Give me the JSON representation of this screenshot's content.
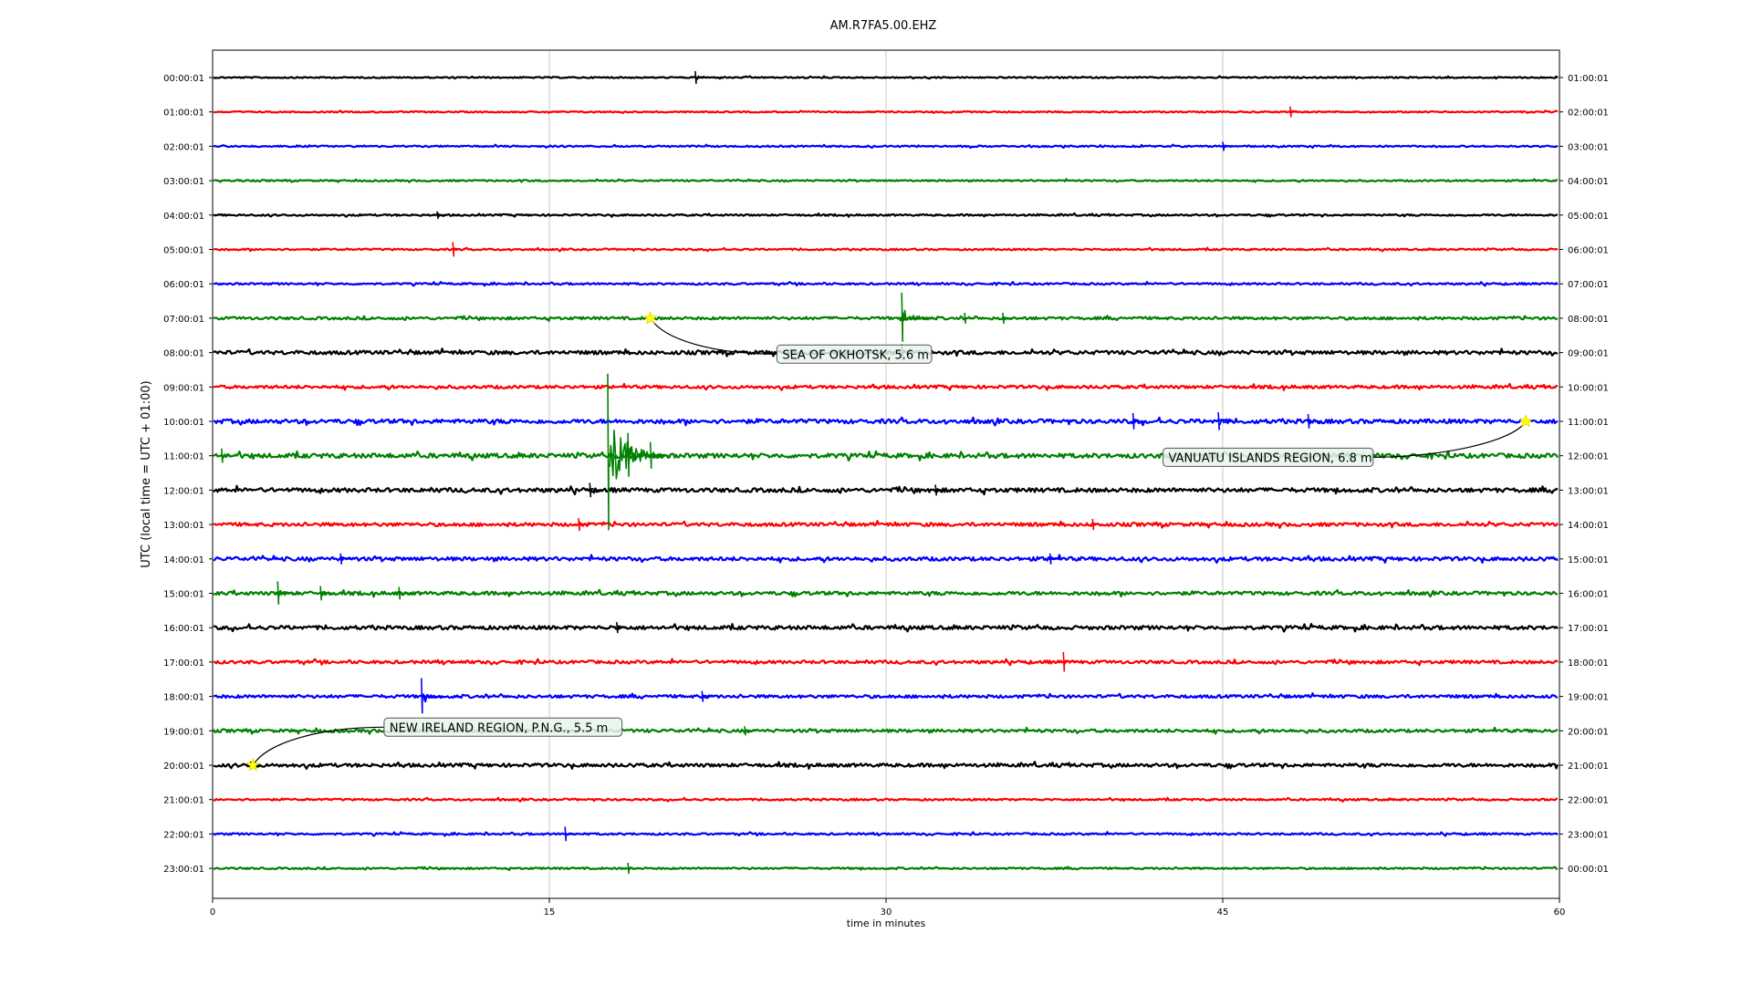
{
  "chart_data": {
    "type": "line",
    "title": "AM.R7FA5.00.EHZ",
    "xlabel": "time in minutes",
    "ylabel": "UTC (local time = UTC + 01:00)",
    "xlim": [
      0,
      60
    ],
    "x_ticks": [
      0,
      15,
      30,
      45,
      60
    ],
    "grid": "vertical",
    "trace_colors": [
      "#000000",
      "#ff0000",
      "#0000ff",
      "#008000"
    ],
    "rows_left": [
      "00:00:01",
      "01:00:01",
      "02:00:01",
      "03:00:01",
      "04:00:01",
      "05:00:01",
      "06:00:01",
      "07:00:01",
      "08:00:01",
      "09:00:01",
      "10:00:01",
      "11:00:01",
      "12:00:01",
      "13:00:01",
      "14:00:01",
      "15:00:01",
      "16:00:01",
      "17:00:01",
      "18:00:01",
      "19:00:01",
      "20:00:01",
      "21:00:01",
      "22:00:01",
      "23:00:01"
    ],
    "rows_right": [
      "01:00:01",
      "02:00:01",
      "03:00:01",
      "04:00:01",
      "05:00:01",
      "06:00:01",
      "07:00:01",
      "08:00:01",
      "09:00:01",
      "10:00:01",
      "11:00:01",
      "12:00:01",
      "13:00:01",
      "14:00:01",
      "15:00:01",
      "16:00:01",
      "17:00:01",
      "18:00:01",
      "19:00:01",
      "20:00:01",
      "21:00:01",
      "22:00:01",
      "23:00:01",
      "00:00:01"
    ],
    "noise_level": [
      0.7,
      0.7,
      0.8,
      0.8,
      0.9,
      0.9,
      1.0,
      1.4,
      2.0,
      1.6,
      2.2,
      2.4,
      2.2,
      1.8,
      2.0,
      1.8,
      2.0,
      1.6,
      1.6,
      1.6,
      1.8,
      1.0,
      1.0,
      0.9
    ],
    "spikes": [
      {
        "row": 0,
        "minute": 21.5,
        "amplitude": 7
      },
      {
        "row": 1,
        "minute": 48.0,
        "amplitude": 6
      },
      {
        "row": 2,
        "minute": 45.0,
        "amplitude": 5
      },
      {
        "row": 4,
        "minute": 10.0,
        "amplitude": 4
      },
      {
        "row": 5,
        "minute": 10.7,
        "amplitude": 8
      },
      {
        "row": 7,
        "minute": 30.7,
        "amplitude": 28
      },
      {
        "row": 7,
        "minute": 33.5,
        "amplitude": 6
      },
      {
        "row": 7,
        "minute": 35.2,
        "amplitude": 6
      },
      {
        "row": 8,
        "minute": 30.7,
        "amplitude": 9
      },
      {
        "row": 10,
        "minute": 41.0,
        "amplitude": 9
      },
      {
        "row": 10,
        "minute": 44.8,
        "amplitude": 10
      },
      {
        "row": 10,
        "minute": 48.8,
        "amplitude": 8
      },
      {
        "row": 11,
        "minute": 17.6,
        "amplitude": 90
      },
      {
        "row": 11,
        "minute": 18.5,
        "amplitude": 25
      },
      {
        "row": 11,
        "minute": 19.5,
        "amplitude": 15
      },
      {
        "row": 11,
        "minute": 0.4,
        "amplitude": 8
      },
      {
        "row": 12,
        "minute": 16.8,
        "amplitude": 8
      },
      {
        "row": 12,
        "minute": 32.2,
        "amplitude": 6
      },
      {
        "row": 13,
        "minute": 16.3,
        "amplitude": 7
      },
      {
        "row": 13,
        "minute": 39.2,
        "amplitude": 6
      },
      {
        "row": 14,
        "minute": 5.7,
        "amplitude": 6
      },
      {
        "row": 14,
        "minute": 37.3,
        "amplitude": 6
      },
      {
        "row": 15,
        "minute": 2.9,
        "amplitude": 13
      },
      {
        "row": 15,
        "minute": 4.8,
        "amplitude": 8
      },
      {
        "row": 15,
        "minute": 8.3,
        "amplitude": 7
      },
      {
        "row": 16,
        "minute": 18.0,
        "amplitude": 6
      },
      {
        "row": 17,
        "minute": 37.9,
        "amplitude": 11
      },
      {
        "row": 18,
        "minute": 9.3,
        "amplitude": 20
      },
      {
        "row": 18,
        "minute": 21.8,
        "amplitude": 6
      },
      {
        "row": 19,
        "minute": 23.7,
        "amplitude": 5
      },
      {
        "row": 20,
        "minute": 1.7,
        "amplitude": 4
      },
      {
        "row": 22,
        "minute": 15.7,
        "amplitude": 8
      },
      {
        "row": 23,
        "minute": 18.5,
        "amplitude": 6
      }
    ],
    "events": [
      {
        "label": "SEA OF OKHOTSK, 5.6 m",
        "row": 7,
        "minute": 19.5,
        "label_row": 8.15,
        "label_minute": 25.3
      },
      {
        "label": "VANUATU ISLANDS REGION, 6.8 m",
        "row": 10,
        "minute": 58.5,
        "label_row": 11.15,
        "label_minute": 42.5
      },
      {
        "label": "NEW IRELAND REGION, P.N.G., 5.5 m",
        "row": 20,
        "minute": 1.8,
        "label_row": 19.0,
        "label_minute": 7.8
      }
    ],
    "event_marker_color": "#ffff00",
    "annotation_box_color": "#e8f5ec"
  }
}
